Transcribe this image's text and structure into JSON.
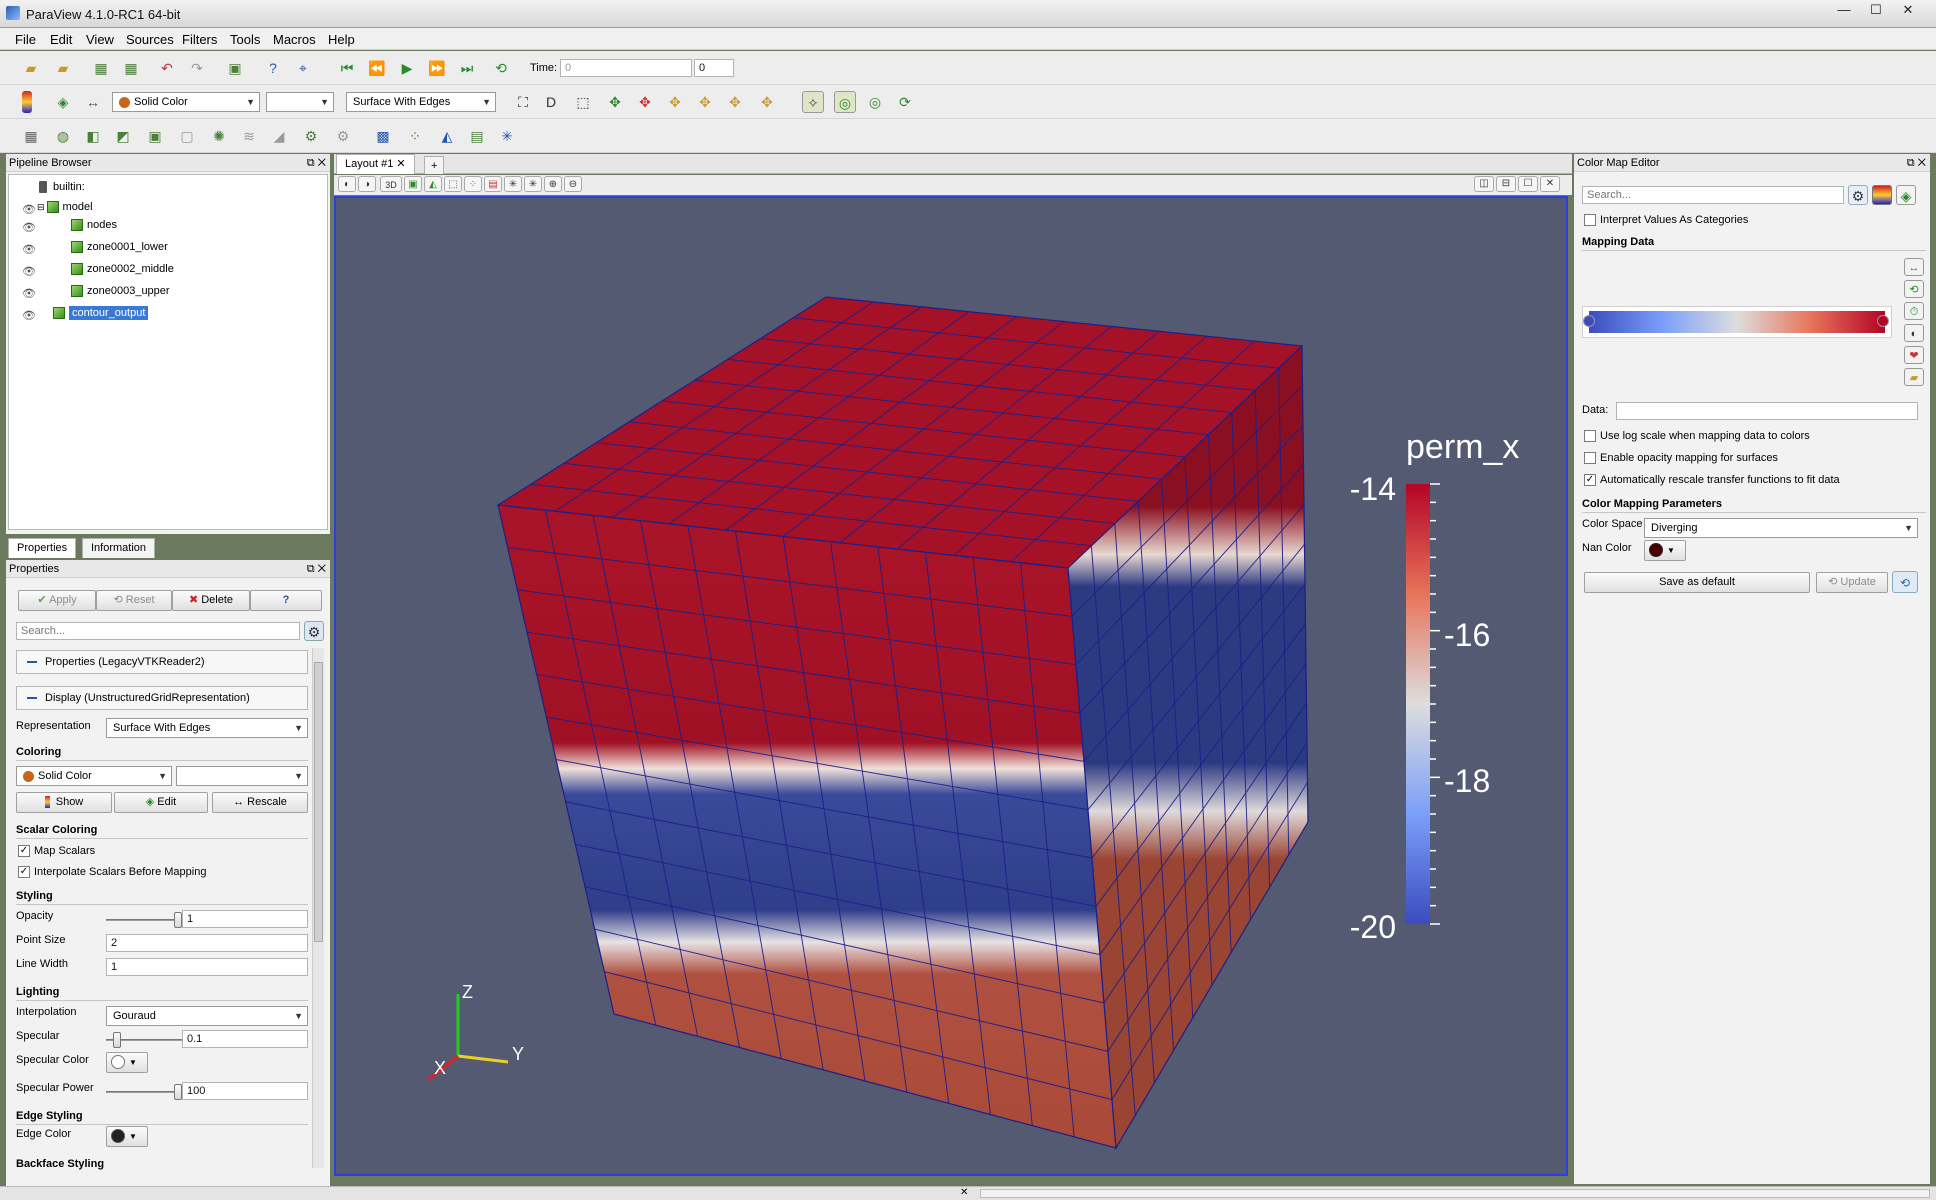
{
  "window": {
    "title": "ParaView 4.1.0-RC1 64-bit",
    "min": "—",
    "max": "☐",
    "close": "✕"
  },
  "menu": [
    "File",
    "Edit",
    "View",
    "Sources",
    "Filters",
    "Tools",
    "Macros",
    "Help"
  ],
  "toolbar": {
    "time_label": "Time:",
    "time_value": "0",
    "time_index": "0",
    "color_by": "Solid Color",
    "component": "",
    "representation": "Surface With Edges"
  },
  "pipeline": {
    "title": "Pipeline Browser",
    "root": "builtin:",
    "items": [
      {
        "label": "model",
        "level": 1
      },
      {
        "label": "nodes",
        "level": 2
      },
      {
        "label": "zone0001_lower",
        "level": 2
      },
      {
        "label": "zone0002_middle",
        "level": 2
      },
      {
        "label": "zone0003_upper",
        "level": 2
      },
      {
        "label": "contour_output",
        "level": 1,
        "selected": true
      }
    ]
  },
  "tabs": {
    "properties": "Properties",
    "information": "Information"
  },
  "properties": {
    "title": "Properties",
    "apply": "Apply",
    "reset": "Reset",
    "delete": "Delete",
    "help": "?",
    "search_placeholder": "Search...",
    "section_reader": "Properties (LegacyVTKReader2)",
    "section_display": "Display (UnstructuredGridRepresentation)",
    "representation_label": "Representation",
    "representation_value": "Surface With Edges",
    "coloring_header": "Coloring",
    "color_by": "Solid Color",
    "component": "",
    "show": "Show",
    "edit": "Edit",
    "rescale": "Rescale",
    "scalar_header": "Scalar Coloring",
    "map_scalars": "Map Scalars",
    "interpolate": "Interpolate Scalars Before Mapping",
    "styling_header": "Styling",
    "opacity_label": "Opacity",
    "opacity_value": "1",
    "opacity_level": 1,
    "point_size_label": "Point Size",
    "point_size_value": "2",
    "line_width_label": "Line Width",
    "line_width_value": "1",
    "lighting_header": "Lighting",
    "interp_label": "Interpolation",
    "interp_value": "Gouraud",
    "specular_label": "Specular",
    "specular_value": "0.1",
    "specular_level": 0.1,
    "specular_color_label": "Specular Color",
    "specular_power_label": "Specular Power",
    "specular_power_value": "100",
    "specular_power_level": 1,
    "edge_header": "Edge Styling",
    "edge_color_label": "Edge Color",
    "backface_header": "Backface Styling"
  },
  "layout": {
    "tab": "Layout #1",
    "add_tab": "+",
    "view_3d": "3D",
    "scalar_title": "perm_x",
    "ticks": [
      "-14",
      "-16",
      "-18",
      "-20"
    ],
    "axis_x": "X",
    "axis_y": "Y",
    "axis_z": "Z"
  },
  "colormap": {
    "title": "Color Map Editor",
    "search_placeholder": "Search...",
    "categories": "Interpret Values As Categories",
    "mapping_header": "Mapping Data",
    "data_label": "Data:",
    "data_value": "",
    "log_scale": "Use log scale when mapping data to colors",
    "opacity_mapping": "Enable opacity mapping for surfaces",
    "auto_rescale": "Automatically rescale transfer functions to fit data",
    "params_header": "Color Mapping Parameters",
    "color_space_label": "Color Space",
    "color_space_value": "Diverging",
    "nan_label": "Nan Color",
    "save_default": "Save as default",
    "update": "Update"
  },
  "colors": {
    "cold": "#3b4cc0",
    "neutral": "#dddddd",
    "hot": "#b40426",
    "view_bg": "#535a72",
    "nan": "#4a0000"
  }
}
